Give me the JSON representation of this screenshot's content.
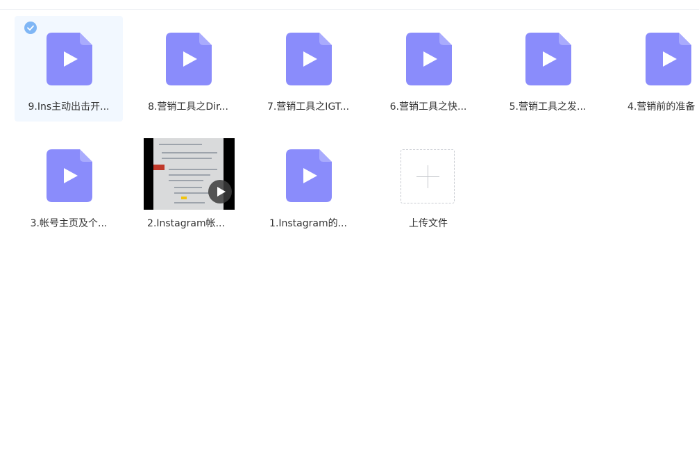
{
  "colors": {
    "file_icon": "#8a8cfb",
    "selected_bg": "#f2f8ff",
    "check": "#7fb6f5",
    "text": "#333333"
  },
  "files": [
    {
      "label": "9.Ins主动出击开...",
      "icon": "video-file-icon",
      "selected": true
    },
    {
      "label": "8.营销工具之Dir...",
      "icon": "video-file-icon"
    },
    {
      "label": "7.营销工具之IGT...",
      "icon": "video-file-icon"
    },
    {
      "label": "6.营销工具之快...",
      "icon": "video-file-icon"
    },
    {
      "label": "5.营销工具之发...",
      "icon": "video-file-icon"
    },
    {
      "label": "4.营销前的准备",
      "icon": "video-file-icon"
    },
    {
      "label": "3.帐号主页及个...",
      "icon": "video-file-icon"
    },
    {
      "label": "2.Instagram帐...",
      "icon": "video-thumbnail"
    },
    {
      "label": "1.Instagram的...",
      "icon": "video-file-icon"
    }
  ],
  "upload": {
    "label": "上传文件",
    "icon": "plus-icon"
  }
}
